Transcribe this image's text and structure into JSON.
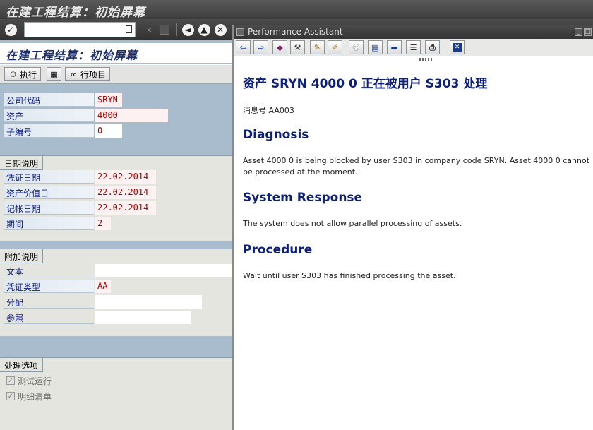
{
  "window": {
    "title": "在建工程结算：初始屏幕"
  },
  "toolbar": {
    "command_value": ""
  },
  "screen": {
    "title": "在建工程结算：初始屏幕",
    "actions": {
      "execute_label": "执行",
      "line_items_label": "行项目"
    }
  },
  "fields": {
    "company_code": {
      "label": "公司代码",
      "value": "SRYN"
    },
    "asset": {
      "label": "资产",
      "value": "4000"
    },
    "subnumber": {
      "label": "子编号",
      "value": "0"
    }
  },
  "dates": {
    "heading": "日期说明",
    "doc_date": {
      "label": "凭证日期",
      "value": "22.02.2014"
    },
    "value_date": {
      "label": "资产价值日",
      "value": "22.02.2014"
    },
    "posting_date": {
      "label": "记帐日期",
      "value": "22.02.2014"
    },
    "period": {
      "label": "期间",
      "value": "2"
    }
  },
  "additional": {
    "heading": "附加说明",
    "text": {
      "label": "文本",
      "value": ""
    },
    "doc_type": {
      "label": "凭证类型",
      "value": "AA"
    },
    "assignment": {
      "label": "分配",
      "value": ""
    },
    "reference": {
      "label": "参照",
      "value": ""
    }
  },
  "processing": {
    "heading": "处理选项",
    "test_run": {
      "label": "测试运行",
      "checked": true
    },
    "detail_list": {
      "label": "明细清单",
      "checked": true
    }
  },
  "assistant": {
    "title": "Performance Assistant",
    "message": "资产  SRYN 4000 0 正在被用户  S303 处理",
    "message_no": "消息号  AA003",
    "diagnosis_heading": "Diagnosis",
    "diagnosis_text": "Asset 4000 0 is being blocked by user S303 in company code SRYN. Asset 4000 0 cannot be processed at the moment.",
    "response_heading": "System Response",
    "response_text": "The system does not allow parallel processing of assets.",
    "procedure_heading": "Procedure",
    "procedure_text": "Wait until user S303 has finished processing the asset."
  }
}
